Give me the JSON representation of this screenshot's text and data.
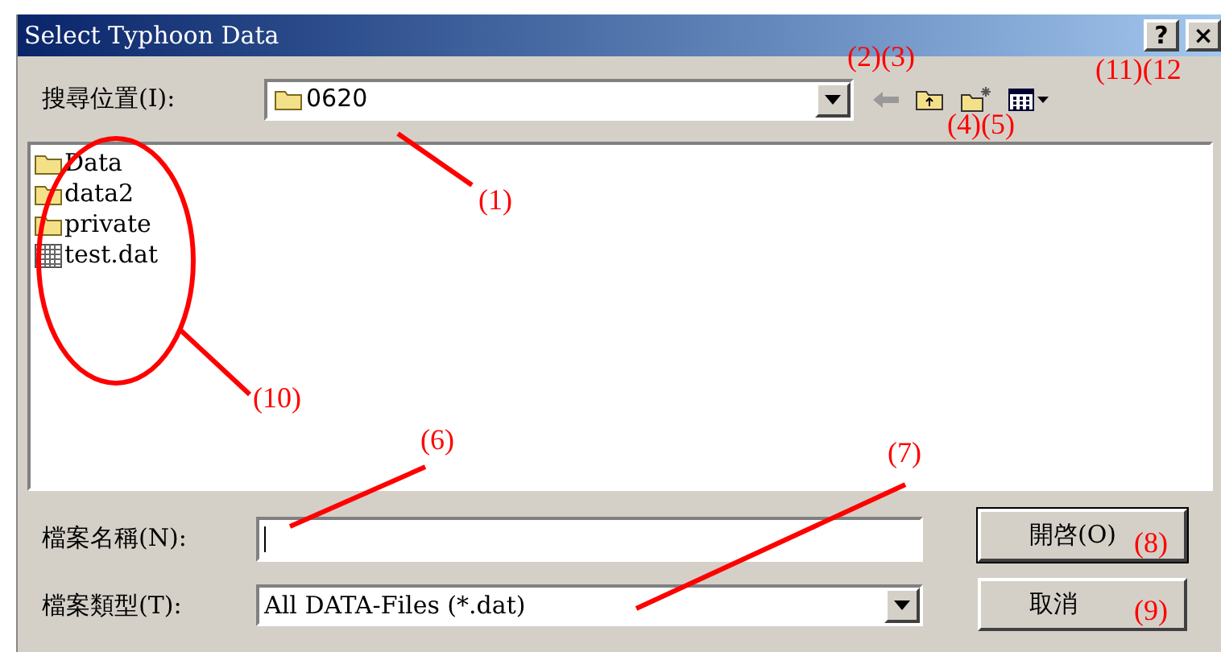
{
  "window": {
    "title": "Select Typhoon Data",
    "title_buttons": [
      "?",
      "×"
    ]
  },
  "look_in": {
    "label": "搜尋位置(I):",
    "value": "0620"
  },
  "files": [
    {
      "name": "Data",
      "kind": "folder"
    },
    {
      "name": "data2",
      "kind": "folder"
    },
    {
      "name": "private",
      "kind": "folder"
    },
    {
      "name": "test.dat",
      "kind": "file"
    }
  ],
  "file_name": {
    "label": "檔案名稱(N):"
  },
  "file_type": {
    "label": "檔案類型(T):",
    "value": "All DATA-Files (*.dat)"
  },
  "buttons": [
    "開啓(O)",
    "取消"
  ],
  "annotations": [
    "(1)",
    "(2)(3)",
    "(4)(5)",
    "(6)",
    "(7)",
    "(8)",
    "(9)",
    "(10)",
    "(11)(12"
  ]
}
